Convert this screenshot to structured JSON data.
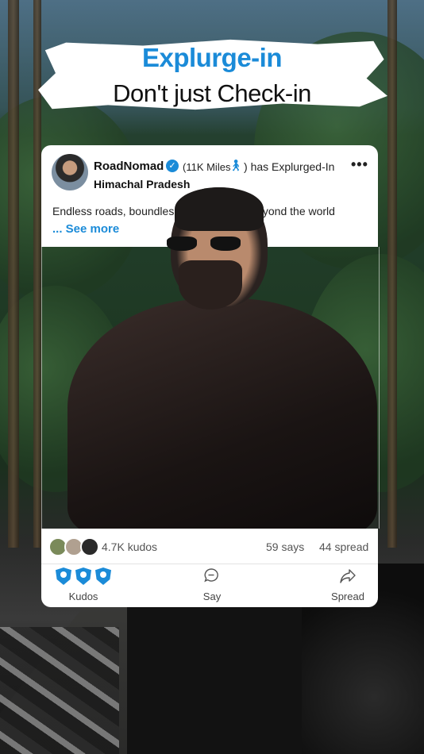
{
  "header": {
    "brand": "Explurge-in",
    "tagline": "Don't just Check-in"
  },
  "post": {
    "username": "RoadNomad",
    "miles": "(11K Miles",
    "miles_close": ")",
    "action": "has Explurged-In",
    "more": "•••",
    "place": "Himachal Pradesh",
    "caption_left": "Endless roads, boundles",
    "caption_right": "beyond the world",
    "see_more": "... See more"
  },
  "stats": {
    "kudos": "4.7K kudos",
    "says": "59 says",
    "spread": "44 spread"
  },
  "actions": {
    "kudos": "Kudos",
    "say": "Say",
    "spread": "Spread"
  },
  "colors": {
    "accent": "#1b8bd8"
  },
  "icons": [
    "verified-icon",
    "hiker-icon",
    "more-icon",
    "kudos-shield-icon",
    "say-bubble-icon",
    "spread-arrow-icon"
  ]
}
